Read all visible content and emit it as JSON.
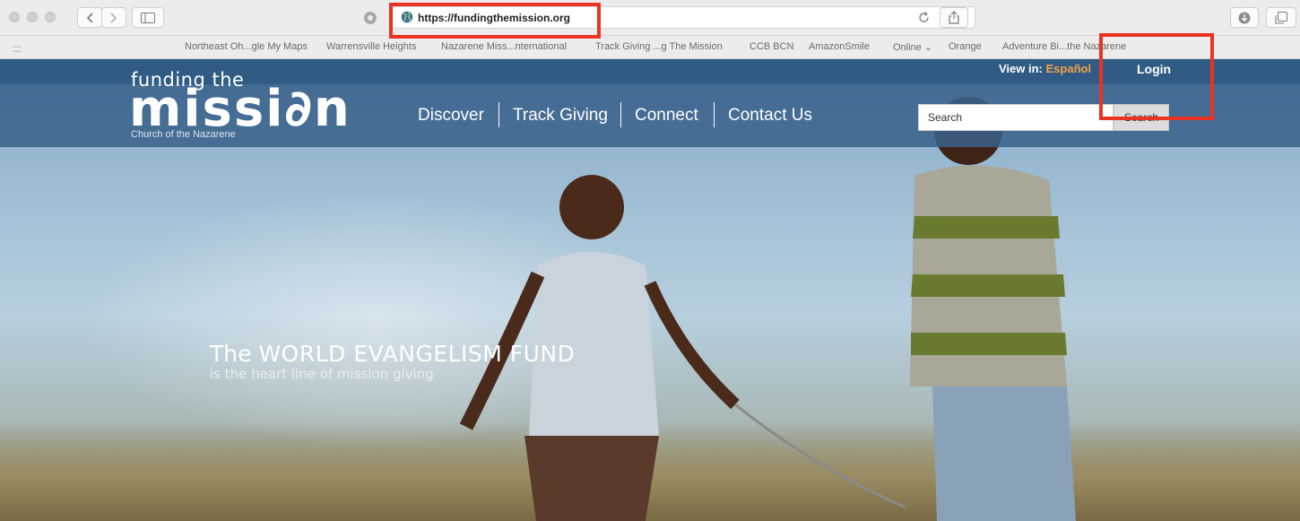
{
  "browser": {
    "url": "https://fundingthemission.org",
    "bookmarks": [
      "Northeast Oh...gle My Maps",
      "Warrensville Heights",
      "Nazarene Miss...nternational",
      "Track Giving ...g The Mission",
      "CCB BCN",
      "AmazonSmile",
      "Online ⌄",
      "Orange",
      "Adventure Bi...the Nazarene"
    ]
  },
  "site": {
    "logo_line1": "funding the",
    "logo_line2": "missi∂n",
    "logo_sub": "Church of the Nazarene",
    "view_in_label": "View in: ",
    "view_in_language": "Español",
    "login_label": "Login",
    "nav": [
      "Discover",
      "Track Giving",
      "Connect",
      "Contact Us"
    ],
    "search_placeholder": "Search",
    "search_button": "Search"
  },
  "hero": {
    "title_prefix": "The ",
    "title_emphasis": "WORLD EVANGELISM FUND",
    "subtitle": "is the heart line of mission giving"
  },
  "colors": {
    "header_bg": "#3a628a",
    "topbar_bg": "#2f5b84",
    "accent_orange": "#f4a04a",
    "annotation_red": "#ea3323"
  }
}
